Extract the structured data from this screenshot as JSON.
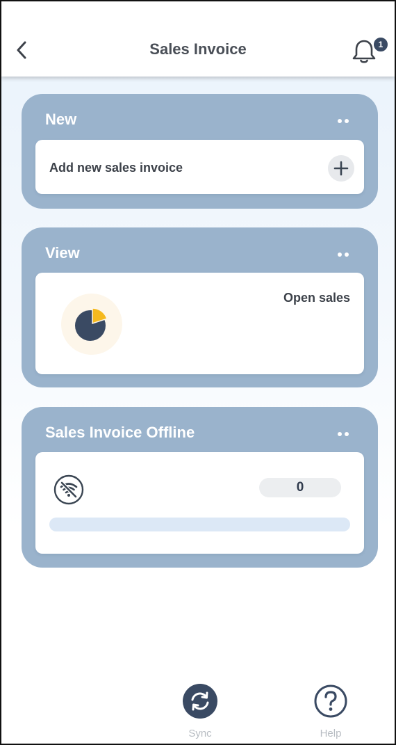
{
  "header": {
    "title": "Sales Invoice",
    "notification_count": "1"
  },
  "sections": {
    "new": {
      "title": "New",
      "add_label": "Add new sales invoice"
    },
    "view": {
      "title": "View",
      "open_sales_label": "Open sales",
      "pie_share": 0.2
    },
    "offline": {
      "title": "Sales Invoice Offline",
      "count": "0",
      "progress": 0
    }
  },
  "bottom_bar": {
    "sync_label": "Sync",
    "help_label": "Help"
  },
  "icons": {
    "back": "chevron-left-icon",
    "bell": "bell-icon",
    "plus": "plus-icon",
    "pie": "pie-chart-icon",
    "wifi_off": "wifi-off-icon",
    "sync": "sync-icon",
    "help": "help-icon"
  },
  "colors": {
    "section_bg": "#9ab3cc",
    "dark_navy": "#3a4a63",
    "pie_accent": "#f5b91e",
    "progress_track": "#dce8f6"
  }
}
